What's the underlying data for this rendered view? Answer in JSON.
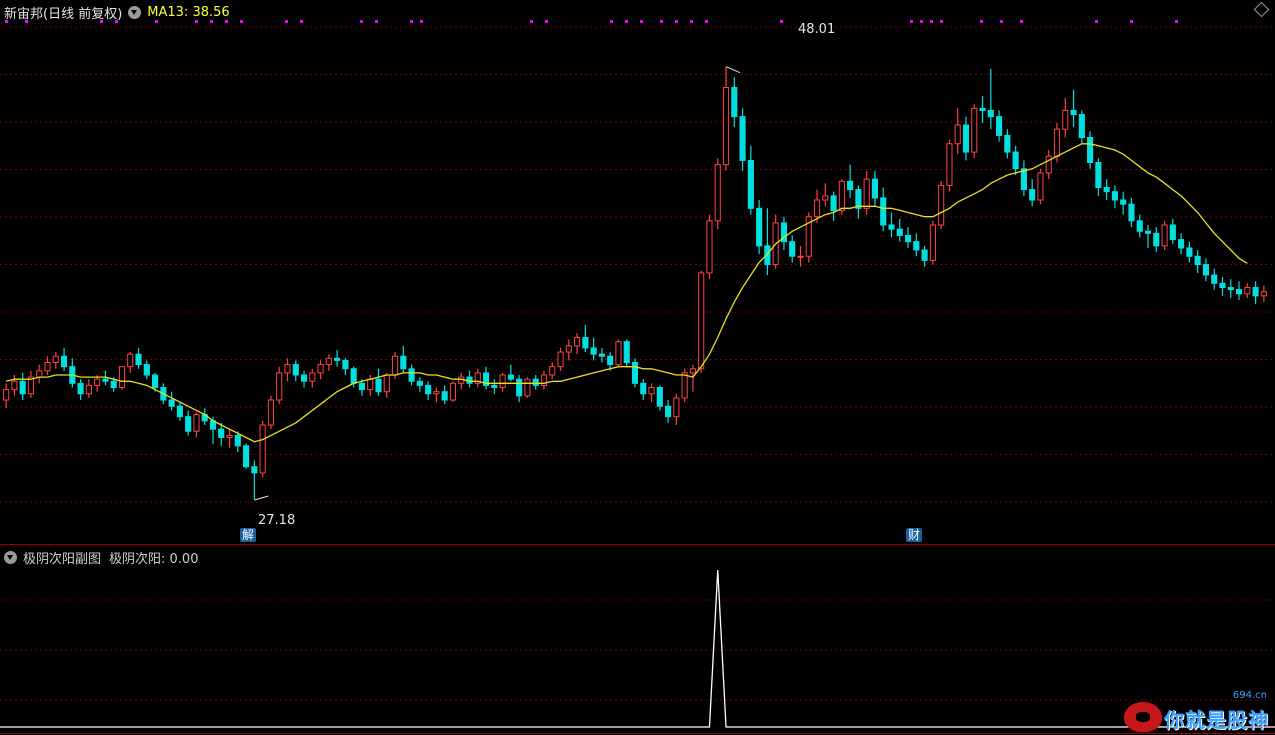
{
  "header": {
    "stock_name": "新宙邦(日线 前复权)",
    "ma_label": "MA13: 38.56"
  },
  "sub_header": {
    "title": "极阴次阳副图",
    "value_label": "极阴次阳: 0.00"
  },
  "annotations": {
    "high_label": "48.01",
    "low_label": "27.18",
    "marker_jie": "解",
    "marker_cai": "财"
  },
  "watermark": {
    "text": "你就是股神",
    "site": "694.cn"
  },
  "colors": {
    "up": "#ff4040",
    "down": "#00e0e0",
    "ma": "#e8e020",
    "grid": "#7a0000",
    "dots": "#ff00ff",
    "separator": "#9a0000",
    "sub_line": "#ffffff"
  },
  "chart_data": {
    "type": "candlestick",
    "price_range": [
      26.0,
      50.0
    ],
    "ma13_last": 38.56,
    "candles_ohlc": [
      [
        32.0,
        32.8,
        31.6,
        32.5
      ],
      [
        32.5,
        33.2,
        32.2,
        32.9
      ],
      [
        32.9,
        33.3,
        32.0,
        32.3
      ],
      [
        32.3,
        33.4,
        32.1,
        33.1
      ],
      [
        33.1,
        33.7,
        32.8,
        33.4
      ],
      [
        33.4,
        34.1,
        33.2,
        33.8
      ],
      [
        33.8,
        34.3,
        33.5,
        34.1
      ],
      [
        34.1,
        34.5,
        33.4,
        33.6
      ],
      [
        33.6,
        34.0,
        32.6,
        32.8
      ],
      [
        32.8,
        33.0,
        32.0,
        32.3
      ],
      [
        32.3,
        33.0,
        32.1,
        32.7
      ],
      [
        32.7,
        33.2,
        32.4,
        33.0
      ],
      [
        33.0,
        33.4,
        32.7,
        32.9
      ],
      [
        32.9,
        33.1,
        32.4,
        32.6
      ],
      [
        32.6,
        33.6,
        32.5,
        33.6
      ],
      [
        33.6,
        34.3,
        33.3,
        34.2
      ],
      [
        34.2,
        34.5,
        33.5,
        33.7
      ],
      [
        33.7,
        33.9,
        33.0,
        33.2
      ],
      [
        33.2,
        33.3,
        32.4,
        32.6
      ],
      [
        32.6,
        32.8,
        31.8,
        32.0
      ],
      [
        32.0,
        32.4,
        31.5,
        31.7
      ],
      [
        31.7,
        31.9,
        31.0,
        31.2
      ],
      [
        31.2,
        31.5,
        30.3,
        30.5
      ],
      [
        30.5,
        31.4,
        30.2,
        31.3
      ],
      [
        31.3,
        31.6,
        30.8,
        31.0
      ],
      [
        31.0,
        31.2,
        29.9,
        30.6
      ],
      [
        30.6,
        30.9,
        29.8,
        30.2
      ],
      [
        30.2,
        30.6,
        29.7,
        30.3
      ],
      [
        30.3,
        30.5,
        29.5,
        29.8
      ],
      [
        29.8,
        29.9,
        28.7,
        28.8
      ],
      [
        28.8,
        29.1,
        27.2,
        28.5
      ],
      [
        28.5,
        31.0,
        28.3,
        30.8
      ],
      [
        30.8,
        32.2,
        30.6,
        32.0
      ],
      [
        32.0,
        33.6,
        31.8,
        33.3
      ],
      [
        33.3,
        34.0,
        32.9,
        33.7
      ],
      [
        33.7,
        33.9,
        32.9,
        33.2
      ],
      [
        33.2,
        33.4,
        32.6,
        32.9
      ],
      [
        32.9,
        33.5,
        32.6,
        33.3
      ],
      [
        33.3,
        33.9,
        33.0,
        33.7
      ],
      [
        33.7,
        34.2,
        33.4,
        34.0
      ],
      [
        34.0,
        34.4,
        33.6,
        33.9
      ],
      [
        33.9,
        34.0,
        33.2,
        33.5
      ],
      [
        33.5,
        33.6,
        32.6,
        32.8
      ],
      [
        32.8,
        33.0,
        32.2,
        32.5
      ],
      [
        32.5,
        33.2,
        32.2,
        33.0
      ],
      [
        33.0,
        33.5,
        32.2,
        32.4
      ],
      [
        32.4,
        33.3,
        32.1,
        33.2
      ],
      [
        33.2,
        34.3,
        33.0,
        34.1
      ],
      [
        34.1,
        34.6,
        33.3,
        33.5
      ],
      [
        33.5,
        33.7,
        32.7,
        32.9
      ],
      [
        32.9,
        33.1,
        32.4,
        32.7
      ],
      [
        32.7,
        32.9,
        32.0,
        32.3
      ],
      [
        32.3,
        32.6,
        31.9,
        32.4
      ],
      [
        32.4,
        32.7,
        31.8,
        32.0
      ],
      [
        32.0,
        32.9,
        31.9,
        32.8
      ],
      [
        32.8,
        33.3,
        32.5,
        33.1
      ],
      [
        33.1,
        33.4,
        32.6,
        32.8
      ],
      [
        32.8,
        33.5,
        32.6,
        33.3
      ],
      [
        33.3,
        33.6,
        32.5,
        32.7
      ],
      [
        32.7,
        33.0,
        32.3,
        32.6
      ],
      [
        32.6,
        33.3,
        32.4,
        33.2
      ],
      [
        33.2,
        33.7,
        32.9,
        33.0
      ],
      [
        33.0,
        33.2,
        31.9,
        32.2
      ],
      [
        32.2,
        33.1,
        32.1,
        33.0
      ],
      [
        33.0,
        33.2,
        32.5,
        32.7
      ],
      [
        32.7,
        33.4,
        32.5,
        33.2
      ],
      [
        33.2,
        33.8,
        33.0,
        33.6
      ],
      [
        33.6,
        34.5,
        33.4,
        34.3
      ],
      [
        34.3,
        34.9,
        33.9,
        34.6
      ],
      [
        34.6,
        35.2,
        34.2,
        35.0
      ],
      [
        35.0,
        35.6,
        34.3,
        34.5
      ],
      [
        34.5,
        35.0,
        33.9,
        34.2
      ],
      [
        34.2,
        34.5,
        33.8,
        34.1
      ],
      [
        34.1,
        34.3,
        33.4,
        33.7
      ],
      [
        33.7,
        34.9,
        33.6,
        34.8
      ],
      [
        34.8,
        34.9,
        33.6,
        33.8
      ],
      [
        33.8,
        34.0,
        32.6,
        32.8
      ],
      [
        32.8,
        33.0,
        32.0,
        32.3
      ],
      [
        32.3,
        32.8,
        31.9,
        32.6
      ],
      [
        32.6,
        32.7,
        31.5,
        31.7
      ],
      [
        31.7,
        32.0,
        30.9,
        31.2
      ],
      [
        31.2,
        32.3,
        30.8,
        32.1
      ],
      [
        32.1,
        33.5,
        31.9,
        33.3
      ],
      [
        33.3,
        33.7,
        32.4,
        33.5
      ],
      [
        33.5,
        38.2,
        33.3,
        38.1
      ],
      [
        38.1,
        40.9,
        37.8,
        40.6
      ],
      [
        40.6,
        43.6,
        40.2,
        43.3
      ],
      [
        43.3,
        48.0,
        43.0,
        47.0
      ],
      [
        47.0,
        47.5,
        45.1,
        45.6
      ],
      [
        45.6,
        46.0,
        43.0,
        43.5
      ],
      [
        43.5,
        44.2,
        40.9,
        41.2
      ],
      [
        41.2,
        41.6,
        39.0,
        39.4
      ],
      [
        39.4,
        41.2,
        38.0,
        38.5
      ],
      [
        38.5,
        40.9,
        38.3,
        40.5
      ],
      [
        40.5,
        40.8,
        39.2,
        39.6
      ],
      [
        39.6,
        39.9,
        38.6,
        38.9
      ],
      [
        38.9,
        39.4,
        38.4,
        38.9
      ],
      [
        38.9,
        41.0,
        38.6,
        40.8
      ],
      [
        40.8,
        42.1,
        40.5,
        41.6
      ],
      [
        41.6,
        42.4,
        41.3,
        41.8
      ],
      [
        41.8,
        42.0,
        40.6,
        41.1
      ],
      [
        41.1,
        42.6,
        40.9,
        42.5
      ],
      [
        42.5,
        43.3,
        41.7,
        42.1
      ],
      [
        42.1,
        42.3,
        40.7,
        41.2
      ],
      [
        41.2,
        43.0,
        40.9,
        42.6
      ],
      [
        42.6,
        43.0,
        41.3,
        41.7
      ],
      [
        41.7,
        42.2,
        40.1,
        40.4
      ],
      [
        40.4,
        41.0,
        39.8,
        40.2
      ],
      [
        40.2,
        40.7,
        39.6,
        39.9
      ],
      [
        39.9,
        40.3,
        39.3,
        39.6
      ],
      [
        39.6,
        40.0,
        38.9,
        39.2
      ],
      [
        39.2,
        39.4,
        38.4,
        38.7
      ],
      [
        38.7,
        40.6,
        38.5,
        40.4
      ],
      [
        40.4,
        42.5,
        40.2,
        42.3
      ],
      [
        42.3,
        44.5,
        42.0,
        44.3
      ],
      [
        44.3,
        46.0,
        43.8,
        45.2
      ],
      [
        45.2,
        45.6,
        43.5,
        43.9
      ],
      [
        43.9,
        46.2,
        43.6,
        46.0
      ],
      [
        46.0,
        46.6,
        45.3,
        45.9
      ],
      [
        45.9,
        47.9,
        45.0,
        45.6
      ],
      [
        45.6,
        45.9,
        44.4,
        44.7
      ],
      [
        44.7,
        45.0,
        43.6,
        43.9
      ],
      [
        43.9,
        44.2,
        42.8,
        43.1
      ],
      [
        43.1,
        43.5,
        41.8,
        42.1
      ],
      [
        42.1,
        42.6,
        41.3,
        41.6
      ],
      [
        41.6,
        43.1,
        41.4,
        42.9
      ],
      [
        42.9,
        44.0,
        42.6,
        43.7
      ],
      [
        43.7,
        45.3,
        43.4,
        45.0
      ],
      [
        45.0,
        46.5,
        44.6,
        45.9
      ],
      [
        45.9,
        46.9,
        45.1,
        45.7
      ],
      [
        45.7,
        45.9,
        44.3,
        44.6
      ],
      [
        44.6,
        44.9,
        43.1,
        43.4
      ],
      [
        43.4,
        43.6,
        41.8,
        42.2
      ],
      [
        42.2,
        42.6,
        41.6,
        42.0
      ],
      [
        42.0,
        42.3,
        41.2,
        41.6
      ],
      [
        41.6,
        42.0,
        40.9,
        41.4
      ],
      [
        41.4,
        41.7,
        40.3,
        40.6
      ],
      [
        40.6,
        40.9,
        39.8,
        40.1
      ],
      [
        40.1,
        40.4,
        39.3,
        40.0
      ],
      [
        40.0,
        40.3,
        39.1,
        39.4
      ],
      [
        39.4,
        40.6,
        39.2,
        40.4
      ],
      [
        40.4,
        40.7,
        39.5,
        39.7
      ],
      [
        39.7,
        40.0,
        39.0,
        39.3
      ],
      [
        39.3,
        39.6,
        38.6,
        38.9
      ],
      [
        38.9,
        39.2,
        38.1,
        38.5
      ],
      [
        38.5,
        38.8,
        37.7,
        38.0
      ],
      [
        38.0,
        38.3,
        37.3,
        37.6
      ],
      [
        37.6,
        37.9,
        37.0,
        37.4
      ],
      [
        37.4,
        37.8,
        36.9,
        37.3
      ],
      [
        37.3,
        37.7,
        36.8,
        37.1
      ],
      [
        37.1,
        37.6,
        36.9,
        37.4
      ],
      [
        37.4,
        37.7,
        36.6,
        37.0
      ],
      [
        37.0,
        37.5,
        36.7,
        37.2
      ]
    ],
    "ma13": [
      32.9,
      33.0,
      33.0,
      33.0,
      33.1,
      33.1,
      33.2,
      33.2,
      33.2,
      33.1,
      33.1,
      33.1,
      33.1,
      33.0,
      32.9,
      32.9,
      32.8,
      32.7,
      32.5,
      32.3,
      32.1,
      31.9,
      31.7,
      31.5,
      31.3,
      31.0,
      30.8,
      30.6,
      30.4,
      30.2,
      30.0,
      30.1,
      30.3,
      30.5,
      30.7,
      30.9,
      31.2,
      31.5,
      31.8,
      32.1,
      32.4,
      32.6,
      32.8,
      32.9,
      33.0,
      33.1,
      33.2,
      33.2,
      33.3,
      33.3,
      33.3,
      33.2,
      33.2,
      33.1,
      33.0,
      33.0,
      32.9,
      32.9,
      32.8,
      32.8,
      32.8,
      32.8,
      32.8,
      32.8,
      32.8,
      32.8,
      32.9,
      32.9,
      33.0,
      33.1,
      33.2,
      33.3,
      33.4,
      33.5,
      33.6,
      33.6,
      33.6,
      33.5,
      33.5,
      33.4,
      33.3,
      33.2,
      33.2,
      33.1,
      33.6,
      34.2,
      35.0,
      35.9,
      36.7,
      37.4,
      38.0,
      38.6,
      39.0,
      39.5,
      39.8,
      40.1,
      40.3,
      40.5,
      40.7,
      40.9,
      41.0,
      41.2,
      41.2,
      41.3,
      41.3,
      41.3,
      41.2,
      41.2,
      41.1,
      41.0,
      40.9,
      40.8,
      40.8,
      41.0,
      41.2,
      41.5,
      41.7,
      41.9,
      42.1,
      42.4,
      42.6,
      42.8,
      42.9,
      43.0,
      43.1,
      43.3,
      43.5,
      43.7,
      43.9,
      44.1,
      44.3,
      44.3,
      44.2,
      44.1,
      44.0,
      43.8,
      43.5,
      43.2,
      42.9,
      42.7,
      42.4,
      42.1,
      41.8,
      41.4,
      41.0,
      40.5,
      40.0,
      39.6,
      39.2,
      38.8,
      38.56
    ],
    "subchart": {
      "name": "极阴次阳",
      "value": 0.0,
      "signal_index": 86,
      "signal_value": 1
    }
  }
}
